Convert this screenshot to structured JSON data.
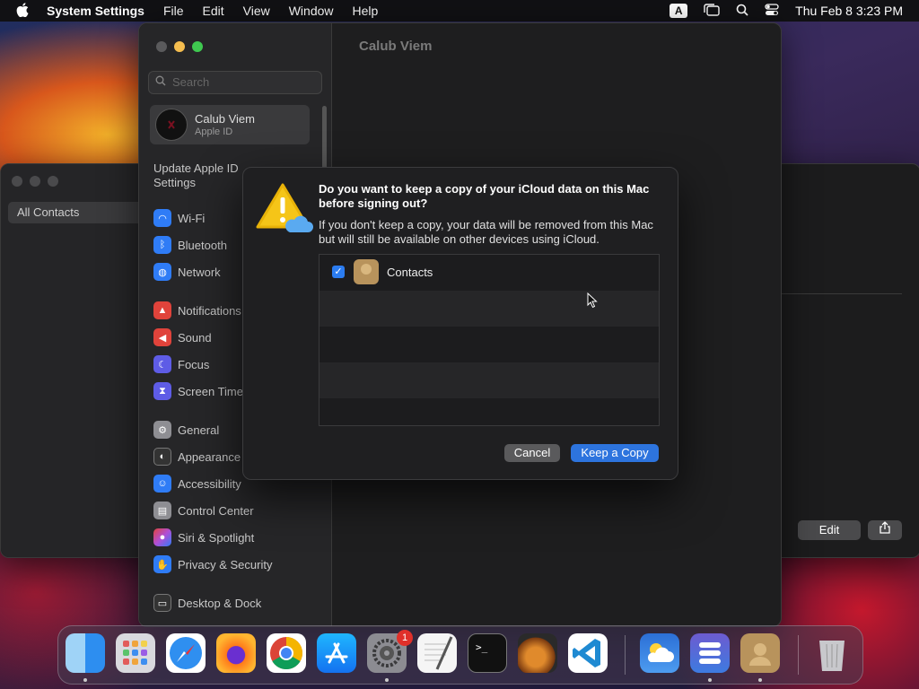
{
  "menubar": {
    "app": "System Settings",
    "menus": [
      "File",
      "Edit",
      "View",
      "Window",
      "Help"
    ],
    "input_indicator": "A",
    "datetime": "Thu Feb 8  3:23 PM"
  },
  "contacts_window": {
    "sidebar_item": "All Contacts",
    "edit_label": "Edit"
  },
  "settings_window": {
    "search_placeholder": "Search",
    "account_name": "Calub Viem",
    "account_sub": "Apple ID",
    "update_text": "Update Apple ID Settings",
    "header_title": "Calub Viem",
    "nav": [
      {
        "label": "Wi-Fi",
        "color": "#2f7cf6",
        "icon": "wifi-icon"
      },
      {
        "label": "Bluetooth",
        "color": "#2f7cf6",
        "icon": "bluetooth-icon"
      },
      {
        "label": "Network",
        "color": "#2f7cf6",
        "icon": "globe-icon"
      },
      {
        "label": "Notifications",
        "color": "#e0433b",
        "icon": "bell-icon"
      },
      {
        "label": "Sound",
        "color": "#e0433b",
        "icon": "speaker-icon"
      },
      {
        "label": "Focus",
        "color": "#5e5ce6",
        "icon": "moon-icon"
      },
      {
        "label": "Screen Time",
        "color": "#5e5ce6",
        "icon": "hourglass-icon"
      },
      {
        "label": "General",
        "color": "#8e8e93",
        "icon": "gear-icon"
      },
      {
        "label": "Appearance",
        "color": "#333333",
        "icon": "appearance-icon"
      },
      {
        "label": "Accessibility",
        "color": "#2f7cf6",
        "icon": "accessibility-icon"
      },
      {
        "label": "Control Center",
        "color": "#8e8e93",
        "icon": "control-center-icon"
      },
      {
        "label": "Siri & Spotlight",
        "color": "#b04fd6",
        "icon": "siri-icon"
      },
      {
        "label": "Privacy & Security",
        "color": "#2f7cf6",
        "icon": "hand-icon"
      },
      {
        "label": "Desktop & Dock",
        "color": "#333333",
        "icon": "dock-icon"
      }
    ]
  },
  "dialog": {
    "heading": "Do you want to keep a copy of your iCloud data on this Mac before signing out?",
    "body": "If you don't keep a copy, your data will be removed from this Mac but will still be available on other devices using iCloud.",
    "item_label": "Contacts",
    "item_checked": true,
    "cancel_label": "Cancel",
    "keep_label": "Keep a Copy"
  },
  "dock": {
    "settings_badge": "1",
    "apps": [
      "Finder",
      "Launchpad",
      "Safari",
      "Firefox",
      "Chrome",
      "App Store",
      "System Settings",
      "TextEdit",
      "Terminal",
      "GarageBand",
      "Visual Studio Code",
      "Weather",
      "Dashboard",
      "Contacts",
      "Trash"
    ]
  }
}
